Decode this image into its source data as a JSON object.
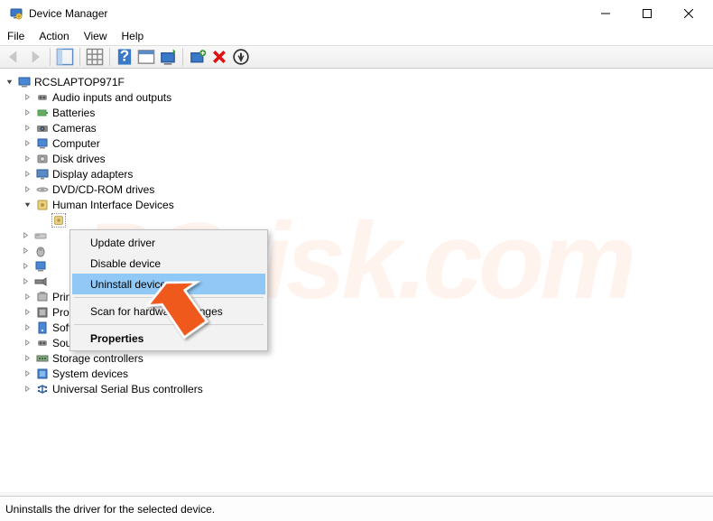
{
  "title": "Device Manager",
  "menu": {
    "file": "File",
    "action": "Action",
    "view": "View",
    "help": "Help"
  },
  "root": "RCSLAPTOP971F",
  "categories": [
    "Audio inputs and outputs",
    "Batteries",
    "Cameras",
    "Computer",
    "Disk drives",
    "Display adapters",
    "DVD/CD-ROM drives",
    "Human Interface Devices",
    "",
    "",
    "",
    "",
    "",
    "Print queues",
    "Processors",
    "Software devices",
    "Sound, video and game controllers",
    "Storage controllers",
    "System devices",
    "Universal Serial Bus controllers"
  ],
  "context": {
    "update": "Update driver",
    "disable": "Disable device",
    "uninstall": "Uninstall device",
    "scan": "Scan for hardware changes",
    "properties": "Properties"
  },
  "status": "Uninstalls the driver for the selected device."
}
